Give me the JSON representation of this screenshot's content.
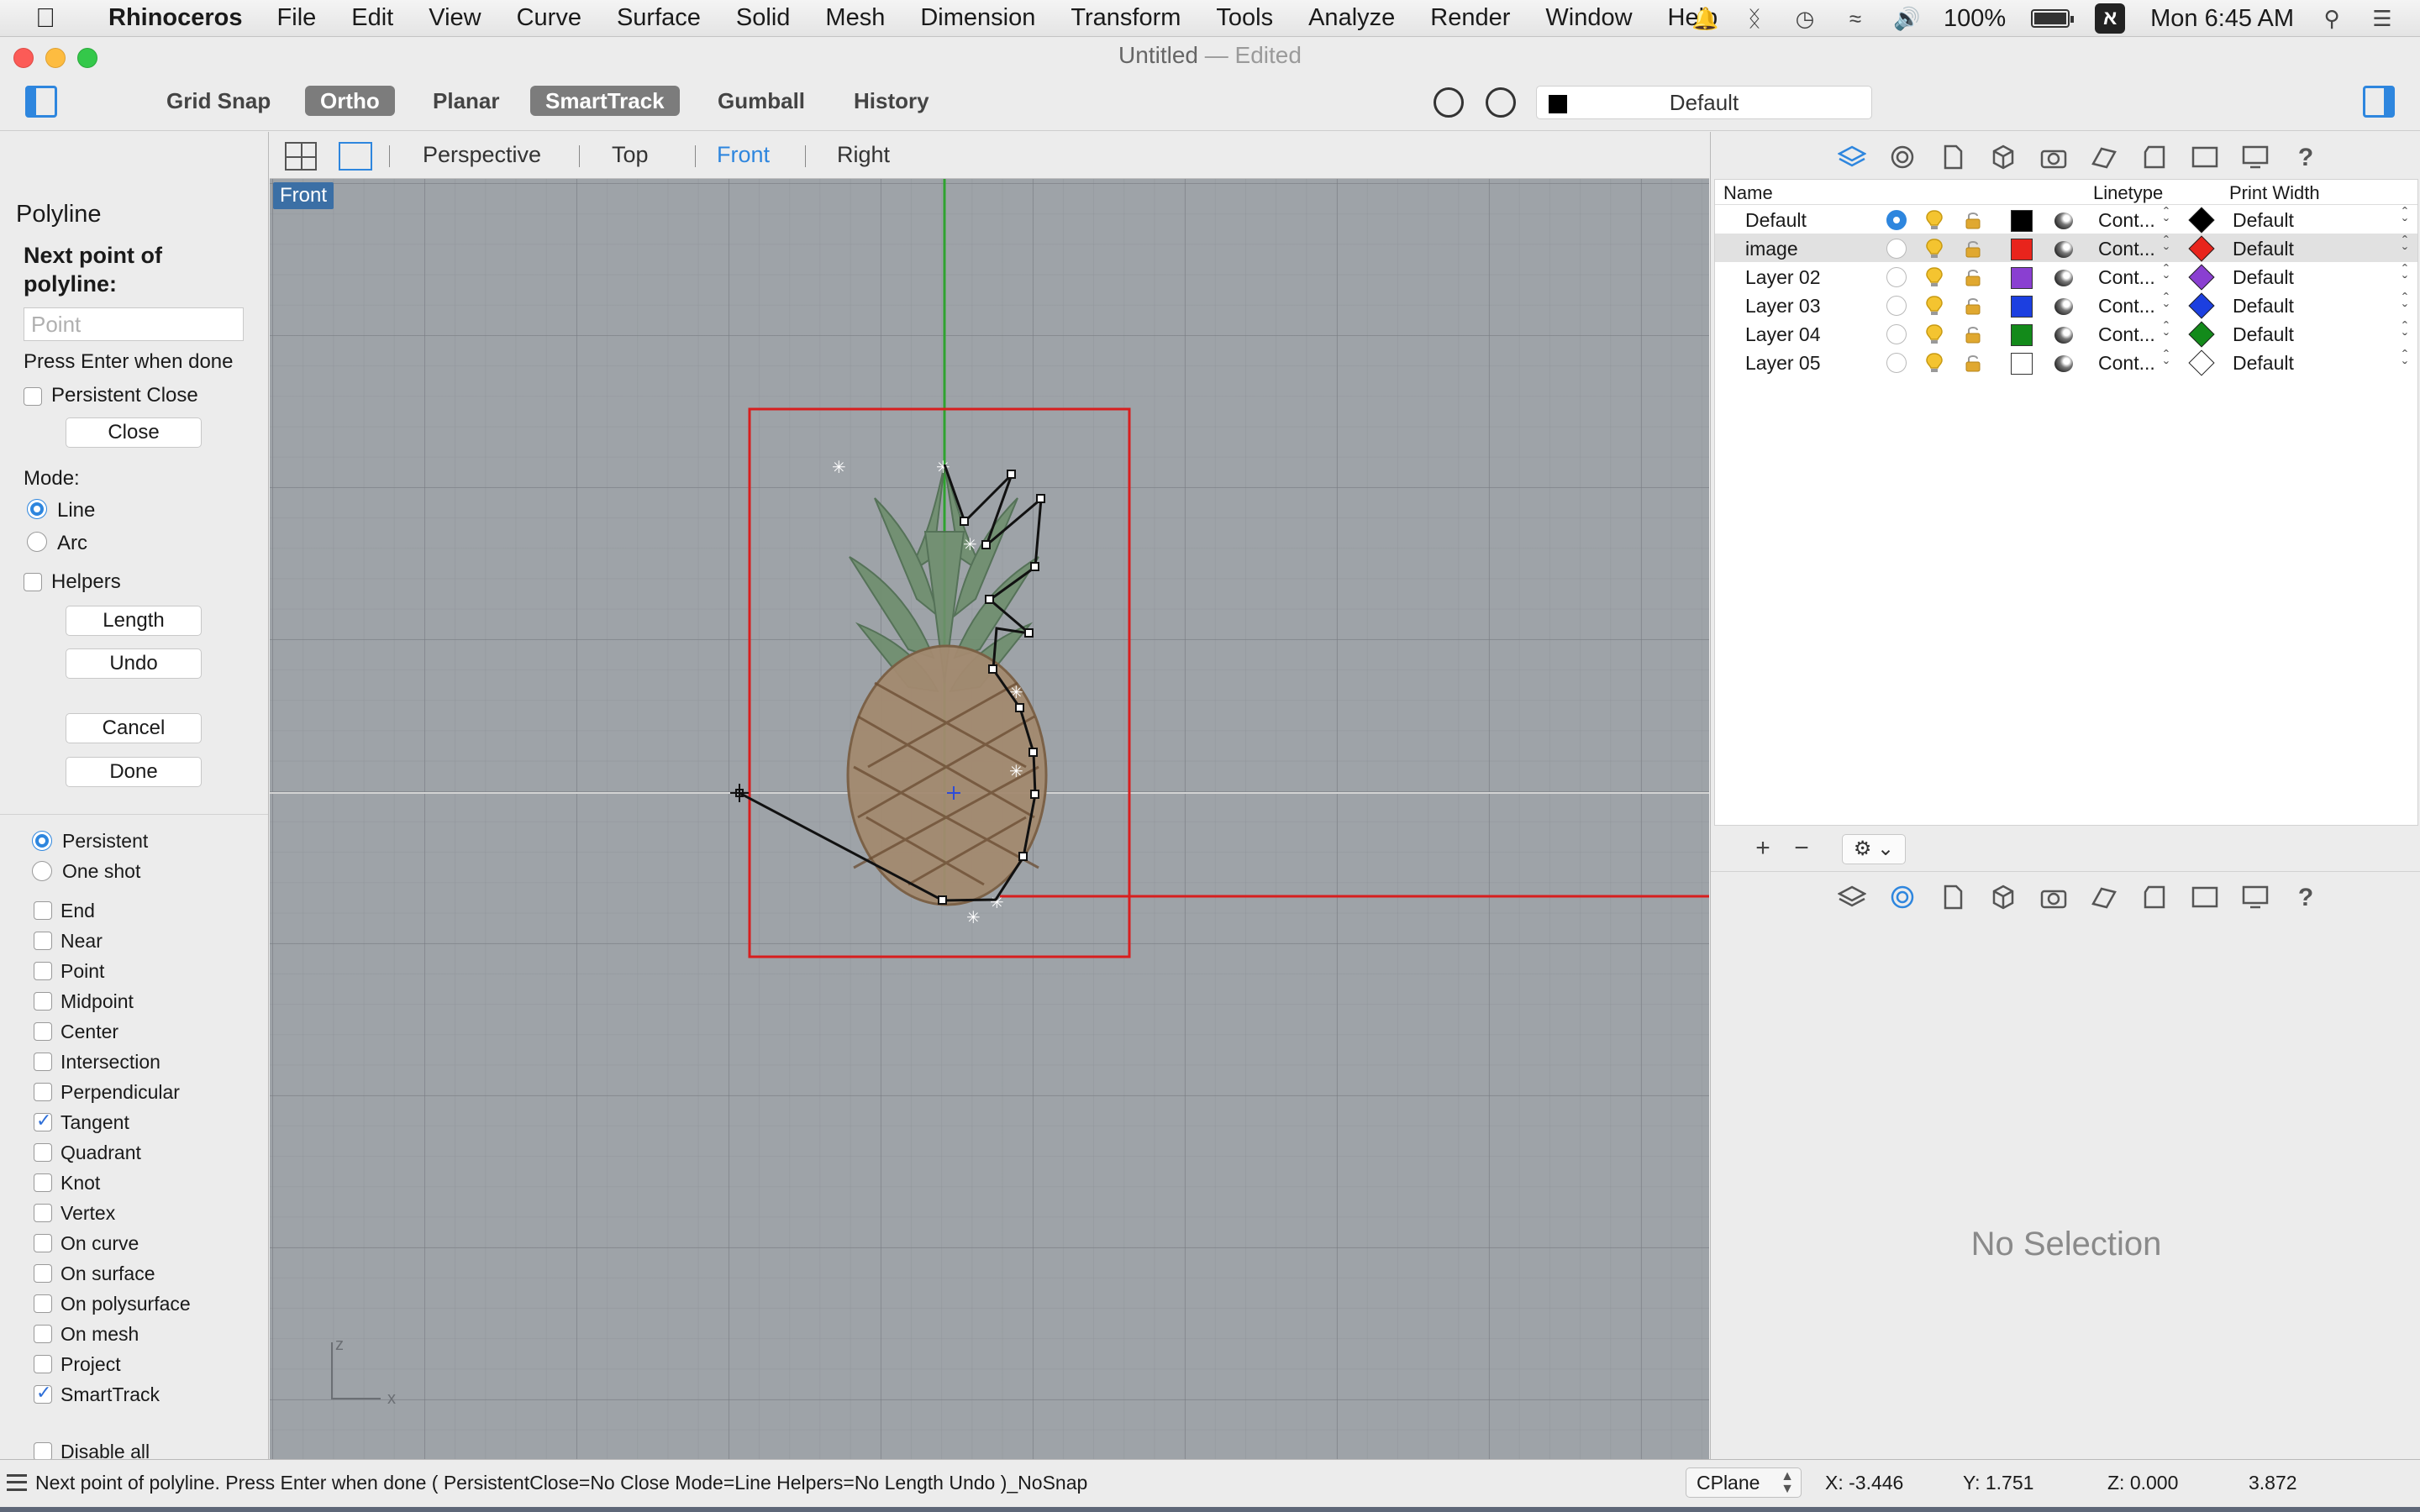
{
  "menubar": {
    "app": "Rhinoceros",
    "items": [
      "File",
      "Edit",
      "View",
      "Curve",
      "Surface",
      "Solid",
      "Mesh",
      "Dimension",
      "Transform",
      "Tools",
      "Analyze",
      "Render",
      "Window",
      "Help"
    ],
    "battery": "100%",
    "clock": "Mon 6:45 AM"
  },
  "window": {
    "title": "Untitled",
    "separator": "—",
    "edited": "Edited"
  },
  "toolbar": {
    "toggles": [
      "Grid Snap",
      "Ortho",
      "Planar",
      "SmartTrack",
      "Gumball",
      "History"
    ],
    "current_layer": "Default"
  },
  "command": {
    "name": "Polyline",
    "prompt": "Next point of polyline:",
    "input_placeholder": "Point",
    "hint": "Press Enter when done",
    "persistent_close": "Persistent Close",
    "close_button": "Close",
    "mode_label": "Mode:",
    "mode_line": "Line",
    "mode_arc": "Arc",
    "helpers": "Helpers",
    "length_button": "Length",
    "undo_button": "Undo",
    "cancel_button": "Cancel",
    "done_button": "Done"
  },
  "osnap": {
    "persistent": "Persistent",
    "one_shot": "One shot",
    "items": [
      {
        "label": "End",
        "checked": false
      },
      {
        "label": "Near",
        "checked": false
      },
      {
        "label": "Point",
        "checked": false
      },
      {
        "label": "Midpoint",
        "checked": false
      },
      {
        "label": "Center",
        "checked": false
      },
      {
        "label": "Intersection",
        "checked": false
      },
      {
        "label": "Perpendicular",
        "checked": false
      },
      {
        "label": "Tangent",
        "checked": true
      },
      {
        "label": "Quadrant",
        "checked": false
      },
      {
        "label": "Knot",
        "checked": false
      },
      {
        "label": "Vertex",
        "checked": false
      },
      {
        "label": "On curve",
        "checked": false
      },
      {
        "label": "On surface",
        "checked": false
      },
      {
        "label": "On polysurface",
        "checked": false
      },
      {
        "label": "On mesh",
        "checked": false
      },
      {
        "label": "Project",
        "checked": false
      },
      {
        "label": "SmartTrack",
        "checked": true
      }
    ],
    "disable_all": "Disable all"
  },
  "viewports": {
    "tabs": [
      "Perspective",
      "Top",
      "Front",
      "Right"
    ],
    "active": "Front",
    "label": "Front",
    "axis_z": "z",
    "axis_x": "x"
  },
  "layers": {
    "headers": {
      "name": "Name",
      "linetype": "Linetype",
      "print_width": "Print Width"
    },
    "rows": [
      {
        "name": "Default",
        "color": "#000000",
        "linetype": "Cont...",
        "print_color": "#000000",
        "print_width": "Default",
        "current": true
      },
      {
        "name": "image",
        "color": "#e8241c",
        "linetype": "Cont...",
        "print_color": "#e8241c",
        "print_width": "Default",
        "current": false
      },
      {
        "name": "Layer 02",
        "color": "#8a3fd1",
        "linetype": "Cont...",
        "print_color": "#8a3fd1",
        "print_width": "Default",
        "current": false
      },
      {
        "name": "Layer 03",
        "color": "#1c3fe0",
        "linetype": "Cont...",
        "print_color": "#1c3fe0",
        "print_width": "Default",
        "current": false
      },
      {
        "name": "Layer 04",
        "color": "#138a1a",
        "linetype": "Cont...",
        "print_color": "#138a1a",
        "print_width": "Default",
        "current": false
      },
      {
        "name": "Layer 05",
        "color": "#ffffff",
        "linetype": "Cont...",
        "print_color": "#ffffff",
        "print_width": "Default",
        "current": false
      }
    ]
  },
  "properties": {
    "empty_text": "No Selection"
  },
  "status": {
    "command_line": "Next point of polyline. Press Enter when done ( PersistentClose=No Close Mode=Line Helpers=No Length Undo )_NoSnap",
    "cplane": "CPlane",
    "x": "X: -3.446",
    "y": "Y: 1.751",
    "z": "Z: 0.000",
    "distance": "3.872"
  },
  "colors": {
    "accent": "#2e86de",
    "viewport_bg": "#9ea3a8",
    "x_axis": "#d81e1e",
    "y_axis": "#2fa32f"
  }
}
